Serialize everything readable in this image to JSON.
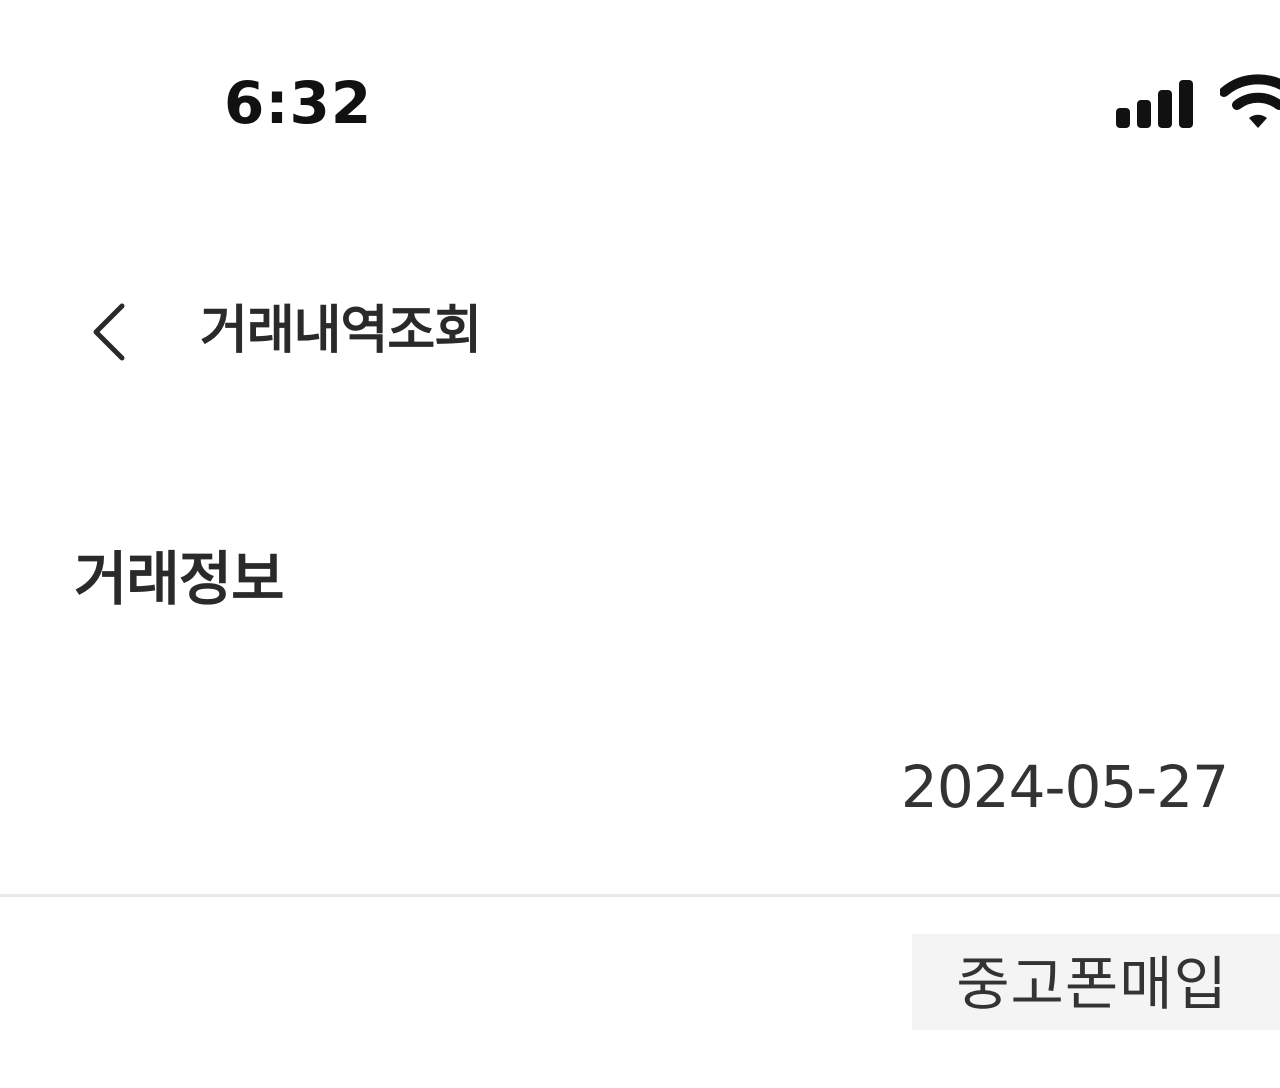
{
  "status_bar": {
    "time": "6:32",
    "signal_icon": "cellular-signal-icon",
    "wifi_icon": "wifi-icon"
  },
  "header": {
    "back_icon": "chevron-left-icon",
    "title": "거래내역조회"
  },
  "section": {
    "title": "거래정보",
    "rows": [
      {
        "value": "2024-05-27"
      },
      {
        "value": "중고폰매입"
      }
    ]
  }
}
